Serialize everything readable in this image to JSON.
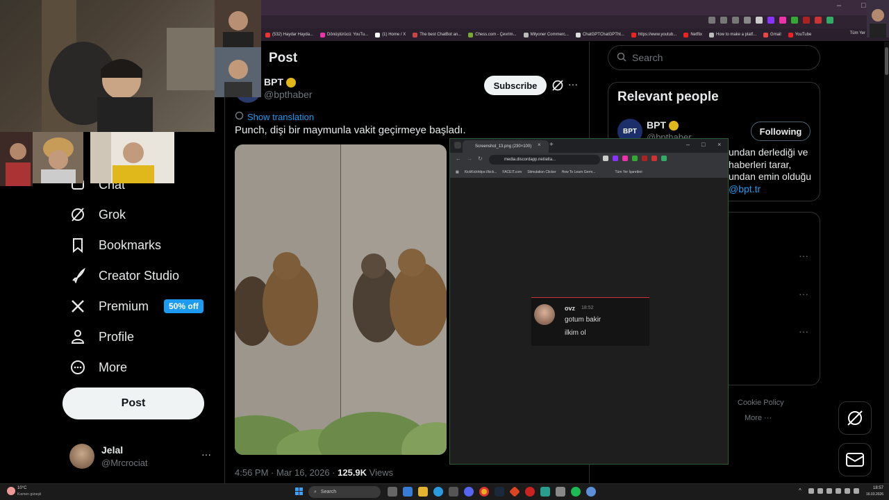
{
  "bookmarks": [
    {
      "label": "(532) Haydar Hayda...",
      "color": "#e33"
    },
    {
      "label": "Dönüştürücü: YouTu...",
      "color": "#e3a"
    },
    {
      "label": "(1) Home / X",
      "color": "#fff"
    },
    {
      "label": "The best ChatBot an...",
      "color": "#c44"
    },
    {
      "label": "Chess.com - Çevrim...",
      "color": "#7a3"
    },
    {
      "label": "Milyoner Commerc...",
      "color": "#bbb"
    },
    {
      "label": "ChatGPTChatGPTht...",
      "color": "#ddd"
    },
    {
      "label": "https://www.youtub...",
      "color": "#e22"
    },
    {
      "label": "Netflix",
      "color": "#e22"
    },
    {
      "label": "How to make a platf...",
      "color": "#bbb"
    },
    {
      "label": "Gmail",
      "color": "#e44"
    },
    {
      "label": "YouTube",
      "color": "#e22"
    }
  ],
  "bookmarks_folder": "Tüm Yer",
  "nav": {
    "chat": "Chat",
    "grok": "Grok",
    "bookmarks": "Bookmarks",
    "creator_studio": "Creator Studio",
    "premium": "Premium",
    "premium_badge": "50% off",
    "profile": "Profile",
    "more": "More",
    "post_button": "Post"
  },
  "account": {
    "name": "Jelal",
    "handle": "@Mrcrociat"
  },
  "post": {
    "header": "Post",
    "author_name": "BPT",
    "author_handle": "@bpthaber",
    "subscribe": "Subscribe",
    "show_translation": "Show translation",
    "text": "Punch, dişi bir maymunla vakit geçirmeye başladı.",
    "time": "4:56 PM · Mar 16, 2026 · ",
    "views_count": "125.9K",
    "views_label": "Views"
  },
  "right": {
    "search_placeholder": "Search",
    "relevant_title": "Relevant people",
    "person_name": "BPT",
    "person_handle": "@bpthaber",
    "following": "Following",
    "bio_line1": "undan derlediği ve",
    "bio_line2": "haberleri tarar,",
    "bio_line3": "undan emin olduğu",
    "bio_line4": "@bpt.tr",
    "footer_cookie": "Cookie Policy",
    "footer_more": "More ···"
  },
  "popup": {
    "tab_title": "Screenshot_13.png (230×100)",
    "url": "media.discordapp.net/atta...",
    "bookmarks": [
      "KickKickhttps://kick...",
      "FACEIT.com",
      "Stimulation Clicker",
      "How To Learn Germ..."
    ],
    "bookmarks_folder": "Tüm Yer İşaretleri",
    "msg_user": "ovz",
    "msg_time": "18:52",
    "msg_line1": "gotum bakir",
    "msg_line2": "ilkim ol"
  },
  "taskbar": {
    "weather_temp": "10°C",
    "weather_desc": "Kısmen güneşli",
    "search": "Search",
    "time": "18:57",
    "date": "16.03.2026"
  },
  "colors": {
    "accent": "#1d9bf0",
    "verified": "#e2b719",
    "discord_red": "#cc3333"
  }
}
